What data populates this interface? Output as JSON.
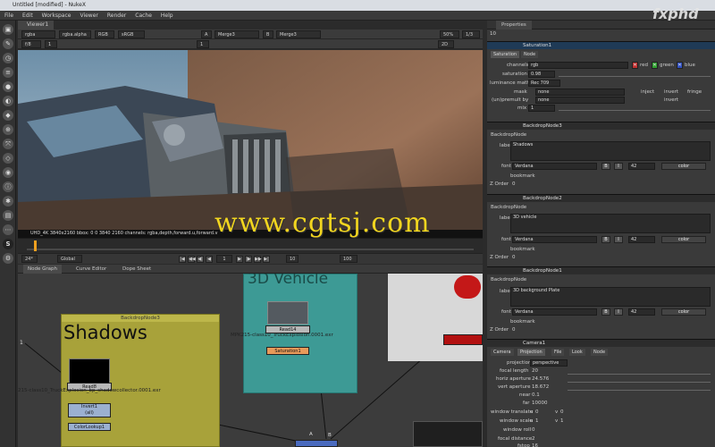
{
  "window": {
    "title": "Untitled [modified] - NukeX"
  },
  "menu": [
    "File",
    "Edit",
    "Workspace",
    "Viewer",
    "Render",
    "Cache",
    "Help"
  ],
  "viewer": {
    "tab": "Viewer1",
    "channels": "rgba",
    "alpha": "rgba.alpha",
    "space": "RGB",
    "lut": "sRGB",
    "input_a": "A",
    "input_a_node": "Merge3",
    "input_b": "B",
    "input_b_node": "Merge3",
    "zoom": "50%",
    "ratio": "1/3",
    "frame_display": "f/8",
    "gain": "1",
    "gamma": "1",
    "view_mode": "2D",
    "info": "UHD_4K 3840x2160  bbox: 0 0 3840 2160 channels: rgba,depth,forward.u,forward.v"
  },
  "playback": {
    "fps": "24*",
    "scope": "Global",
    "frame": "1",
    "increment": "10",
    "end_frame": "100"
  },
  "node_graph": {
    "tabs": [
      "Node Graph",
      "Curve Editor",
      "Dope Sheet"
    ],
    "backdrop_shadows_label": "BackdropNode3",
    "backdrop_shadows_title": "Shadows",
    "backdrop_vehicle_title": "3D Vehicle",
    "read14": "Read14",
    "read14_file": "MPK215-class10_TruckExplosion.0001.exr",
    "saturation1": "Saturation1",
    "read8": "Read8",
    "read8_file": "215-class10_TruckExplosion_bp_shadowcollector.0001.exr",
    "invert1": "Invert1",
    "invert1_sub": "(all)",
    "colorlookup": "ColorLookup1",
    "input_a": "A",
    "input_b": "B",
    "pipe_num": "1"
  },
  "watermark": "www.cgtsj.com",
  "brand": "fxphd",
  "properties": {
    "tab": "Properties",
    "max_panels": "10",
    "saturation": {
      "title": "Saturation1",
      "tabs": [
        "Saturation",
        "Node"
      ],
      "channels_label": "channels",
      "channels_value": "rgb",
      "red": "red",
      "green": "green",
      "blue": "blue",
      "saturation_label": "saturation",
      "saturation_value": "0.98",
      "luminance_label": "luminance math",
      "luminance_value": "Rec 709",
      "mask_label": "mask",
      "mask_value": "none",
      "inject": "inject",
      "invert": "invert",
      "fringe": "fringe",
      "unpremult_label": "(un)premult by",
      "unpremult_value": "none",
      "invert2": "invert",
      "mix_label": "mix",
      "mix_value": "1"
    },
    "backdrop3": {
      "title": "BackdropNode3",
      "tab": "BackdropNode",
      "label_label": "label",
      "label_value": "Shadows",
      "font_label": "font",
      "font_value": "Verdana",
      "font_size": "42",
      "color_label": "color",
      "bookmark": "bookmark",
      "zorder_label": "Z Order",
      "zorder_value": "0"
    },
    "backdrop2": {
      "title": "BackdropNode2",
      "tab": "BackdropNode",
      "label_label": "label",
      "label_value": "3D vehicle",
      "font_label": "font",
      "font_value": "Verdana",
      "font_size": "42",
      "color_label": "color",
      "bookmark": "bookmark",
      "zorder_label": "Z Order",
      "zorder_value": "0"
    },
    "backdrop1": {
      "title": "BackdropNode1",
      "tab": "BackdropNode",
      "label_label": "label",
      "label_value": "3D background Plate",
      "font_label": "font",
      "font_value": "Verdana",
      "font_size": "42",
      "color_label": "color",
      "bookmark": "bookmark",
      "zorder_label": "Z Order",
      "zorder_value": "0"
    },
    "camera": {
      "title": "Camera1",
      "tabs": [
        "Camera",
        "Projection",
        "File",
        "Look",
        "Node"
      ],
      "projection_label": "projection",
      "projection_value": "perspective",
      "focal_label": "focal length",
      "focal_value": "20",
      "haperture_label": "horiz aperture",
      "haperture_value": "24.576",
      "vaperture_label": "vert aperture",
      "vaperture_value": "18.672",
      "near_label": "near",
      "near_value": "0.1",
      "far_label": "far",
      "far_value": "10000",
      "wtranslate_label": "window translate",
      "wtranslate_u": "u",
      "wtranslate_u_value": "0",
      "wtranslate_v": "v",
      "wtranslate_v_value": "0",
      "wscale_label": "window scale",
      "wscale_u": "u",
      "wscale_u_value": "1",
      "wscale_v": "v",
      "wscale_v_value": "1",
      "wroll_label": "window roll",
      "wroll_value": "0",
      "fdist_label": "focal distance",
      "fdist_value": "2",
      "fstop_label": "fstop",
      "fstop_value": "16"
    }
  },
  "colors": {
    "shadows_backdrop": "#a8a23a",
    "vehicle_backdrop": "#3d9a95",
    "active_panel": "#1f3a56",
    "watermark": "#f2d51f"
  }
}
